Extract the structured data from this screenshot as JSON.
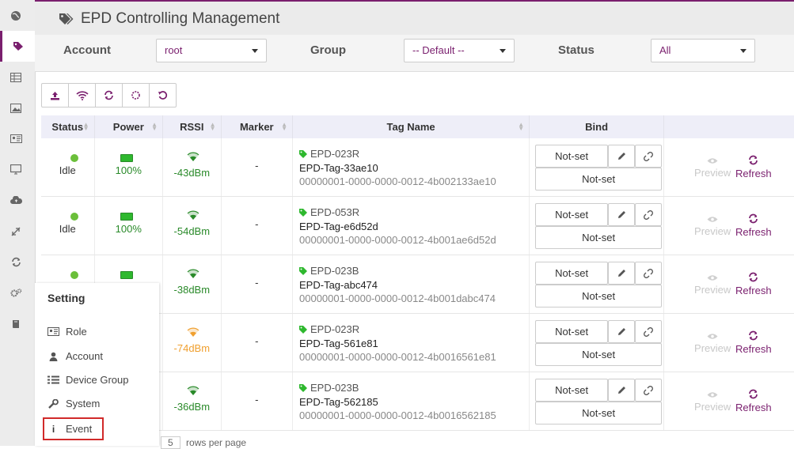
{
  "app": {
    "title": "EPD Controlling Management"
  },
  "sidebar": {
    "icons": [
      "globe-icon",
      "tags-icon",
      "table-icon",
      "image-icon",
      "id-card-icon",
      "monitor-icon",
      "cloud-upload-icon",
      "compress-icon",
      "sync-icon",
      "gears-icon",
      "book-icon"
    ]
  },
  "filters": {
    "account": {
      "label": "Account",
      "value": "root"
    },
    "group": {
      "label": "Group",
      "value": "-- Default --"
    },
    "status": {
      "label": "Status",
      "value": "All"
    }
  },
  "toolbar": {
    "icons": [
      "upload-icon",
      "wifi-icon",
      "refresh-icon",
      "spinner-icon",
      "undo-icon"
    ]
  },
  "table": {
    "headers": {
      "status": "Status",
      "power": "Power",
      "rssi": "RSSI",
      "marker": "Marker",
      "tag_name": "Tag Name",
      "bind": "Bind"
    },
    "rows": [
      {
        "status": "Idle",
        "power": "100%",
        "rssi": "-43dBm",
        "rssi_color": "#2a8a2a",
        "marker": "-",
        "code": "EPD-023R",
        "name": "EPD-Tag-33ae10",
        "uuid": "00000001-0000-0000-0012-4b002133ae10",
        "bind_top": "Not-set",
        "bind_bottom": "Not-set",
        "preview": "Preview",
        "refresh": "Refresh"
      },
      {
        "status": "Idle",
        "power": "100%",
        "rssi": "-54dBm",
        "rssi_color": "#2a8a2a",
        "marker": "-",
        "code": "EPD-053R",
        "name": "EPD-Tag-e6d52d",
        "uuid": "00000001-0000-0000-0012-4b001ae6d52d",
        "bind_top": "Not-set",
        "bind_bottom": "Not-set",
        "preview": "Preview",
        "refresh": "Refresh"
      },
      {
        "status": "",
        "power": "",
        "rssi": "-38dBm",
        "rssi_color": "#2a8a2a",
        "marker": "-",
        "code": "EPD-023B",
        "name": "EPD-Tag-abc474",
        "uuid": "00000001-0000-0000-0012-4b001dabc474",
        "bind_top": "Not-set",
        "bind_bottom": "Not-set",
        "preview": "Preview",
        "refresh": "Refresh"
      },
      {
        "status": "",
        "power": "",
        "rssi": "-74dBm",
        "rssi_color": "#f0a030",
        "marker": "-",
        "code": "EPD-023R",
        "name": "EPD-Tag-561e81",
        "uuid": "00000001-0000-0000-0012-4b0016561e81",
        "bind_top": "Not-set",
        "bind_bottom": "Not-set",
        "preview": "Preview",
        "refresh": "Refresh"
      },
      {
        "status": "",
        "power": "",
        "rssi": "-36dBm",
        "rssi_color": "#2a8a2a",
        "marker": "-",
        "code": "EPD-023B",
        "name": "EPD-Tag-562185",
        "uuid": "00000001-0000-0000-0012-4b0016562185",
        "bind_top": "Not-set",
        "bind_bottom": "Not-set",
        "preview": "Preview",
        "refresh": "Refresh"
      }
    ]
  },
  "settings_menu": {
    "title": "Setting",
    "items": [
      {
        "label": "Role",
        "icon": "id-card-icon"
      },
      {
        "label": "Account",
        "icon": "user-icon"
      },
      {
        "label": "Device Group",
        "icon": "list-icon"
      },
      {
        "label": "System",
        "icon": "wrench-icon"
      },
      {
        "label": "Event",
        "icon": "info-icon"
      }
    ]
  },
  "footer": {
    "page_size": "5",
    "rows_text": "rows per page"
  },
  "colors": {
    "accent": "#7a1f6e",
    "highlight": "#d12a2a",
    "ok": "#2a8a2a"
  }
}
